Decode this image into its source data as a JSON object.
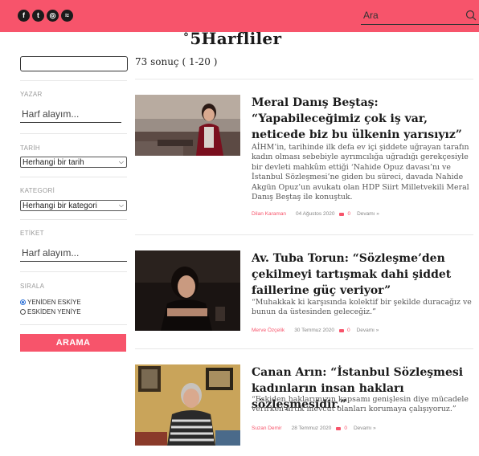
{
  "header": {
    "social": [
      {
        "name": "facebook-icon",
        "glyph": "f"
      },
      {
        "name": "twitter-icon",
        "glyph": "t"
      },
      {
        "name": "instagram-icon",
        "glyph": "◎"
      },
      {
        "name": "rss-icon",
        "glyph": "≈"
      }
    ],
    "search_placeholder": "Ara",
    "brand_color": "#f7546b"
  },
  "logo": {
    "mark": "°",
    "text": "5Harfliler"
  },
  "sidebar": {
    "author_label": "YAZAR",
    "author_placeholder": "Harf alayım...",
    "date_label": "TARİH",
    "date_value": "Herhangi bir tarih",
    "category_label": "KATEGORİ",
    "category_value": "Herhangi bir kategori",
    "tag_label": "ETİKET",
    "tag_placeholder": "Harf alayım...",
    "sort_label": "SIRALA",
    "sort_options": [
      "YENİDEN ESKİYE",
      "ESKİDEN YENİYE"
    ],
    "sort_selected": "YENİDEN ESKİYE",
    "search_button": "ARAMA"
  },
  "results": {
    "count_text": "73 sonuç ( 1-20 )",
    "items": [
      {
        "title": "Meral Danış Beştaş: “Yapabileceğimiz çok iş var, neticede biz bu ülkenin yarısıyız”",
        "excerpt": "AİHM’in, tarihinde ilk defa ev içi şiddete uğrayan tarafın kadın olması sebebiyle ayrımcılığa uğradığı gerekçesiyle bir devleti mahkûm ettiği ‘Nahide Opuz davası’nı ve İstanbul Sözleşmesi’ne giden bu süreci, davada Nahide Akgün Opuz’un avukatı olan HDP Siirt Milletvekili Meral Danış Beştaş ile konuştuk.",
        "author": "Dilan Karaman",
        "date": "04 Ağustos 2020",
        "comments": "0",
        "more": "Devamı »"
      },
      {
        "title": "Av. Tuba Torun: “Sözleşme’den çekilmeyi tartışmak dahi şiddet faillerine güç veriyor”",
        "excerpt": "“Muhakkak ki karşısında kolektif bir şekilde duracağız ve bunun da üstesinden geleceğiz.”",
        "author": "Merve Özçelik",
        "date": "30 Temmuz 2020",
        "comments": "0",
        "more": "Devamı »"
      },
      {
        "title": "Canan Arın: “İstanbul Sözleşmesi kadınların insan hakları sözleşmesidir.”",
        "excerpt": "“Eskiden haklarımızın kapsamı genişlesin diye mücadele verirken artık mevcut olanları korumaya çalışıyoruz.”",
        "author": "Suzan Demir",
        "date": "28 Temmuz 2020",
        "comments": "0",
        "more": "Devamı »"
      }
    ]
  }
}
